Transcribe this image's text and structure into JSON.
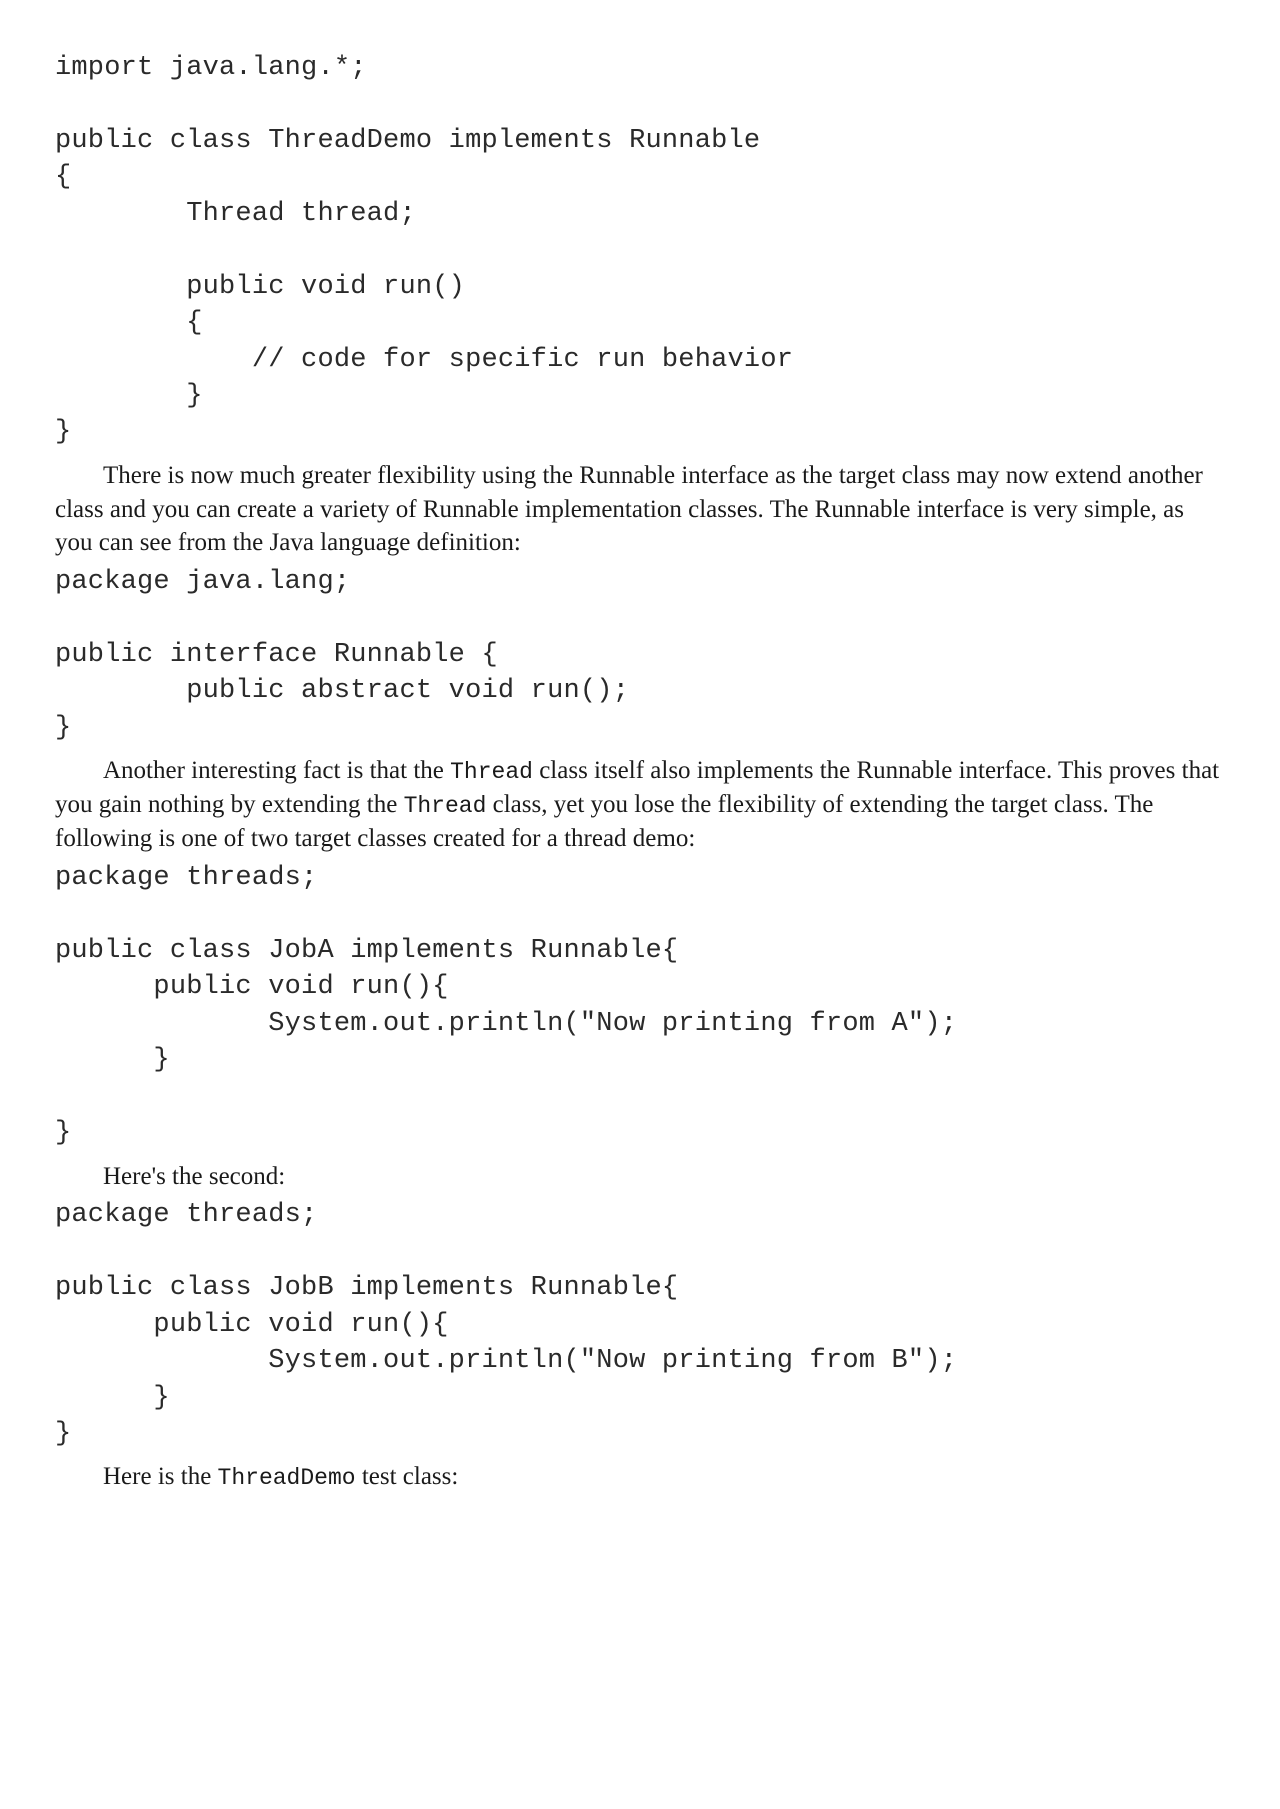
{
  "code1": "import java.lang.*;\n\npublic class ThreadDemo implements Runnable\n{\n        Thread thread;\n\n        public void run()\n        {\n            // code for specific run behavior\n        }\n}",
  "para1": "There is now much greater flexibility using the Runnable interface as the target class may now extend another class and you can create a variety of Runnable implementation classes. The Runnable interface is very simple, as you can see from the Java language definition:",
  "code2": "package java.lang;\n\npublic interface Runnable {\n        public abstract void run();\n}",
  "para2_a": "Another interesting fact is that the ",
  "para2_thread1": "Thread",
  "para2_b": " class itself also implements the Runnable interface. This proves that you gain nothing by extending the ",
  "para2_thread2": "Thread",
  "para2_c": " class, yet you lose the flexibility of extending the target class. The following is one of two target classes created for a thread demo:",
  "code3": "package threads;\n\npublic class JobA implements Runnable{\n      public void run(){\n             System.out.println(\"Now printing from A\");\n      }\n\n}",
  "para3": "Here's the second:",
  "code4": "package threads;\n\npublic class JobB implements Runnable{\n      public void run(){\n             System.out.println(\"Now printing from B\");\n      }\n}",
  "para4_a": "Here is the ",
  "para4_code": "ThreadDemo",
  "para4_b": " test class:"
}
